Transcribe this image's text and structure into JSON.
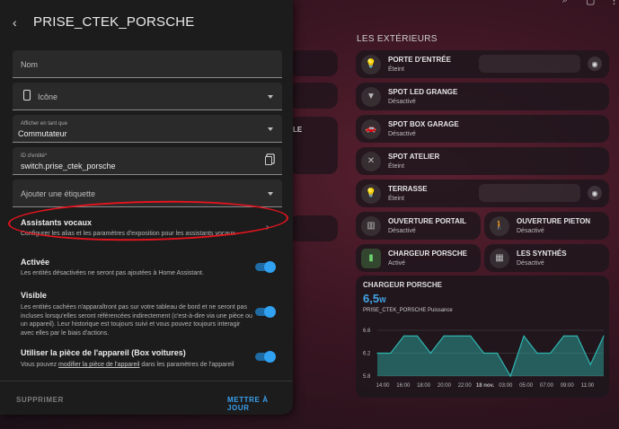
{
  "dialog": {
    "title": "PRISE_CTEK_PORSCHE",
    "name_field": {
      "label": "Nom"
    },
    "icon_field": {
      "label": "Icône"
    },
    "show_as_field": {
      "label": "Afficher en tant que",
      "value": "Commutateur"
    },
    "entity_id_field": {
      "label": "ID d'entité*",
      "value": "switch.prise_ctek_porsche"
    },
    "tag_field": {
      "label": "Ajouter une étiquette"
    },
    "voice_assistants": {
      "title": "Assistants vocaux",
      "description": "Configurer les alias et les paramètres d'exposition pour les assistants vocaux"
    },
    "enabled": {
      "title": "Activée",
      "description": "Les entités désactivées ne seront pas ajoutées à Home Assistant.",
      "on": true
    },
    "visible": {
      "title": "Visible",
      "description": "Les entités cachées n'apparaîtront pas sur votre tableau de bord et ne seront pas incluses lorsqu'elles seront référencées indirectement (c'est-à-dire via une pièce ou un appareil). Leur historique est toujours suivi et vous pouvez toujours interagir avec elles par le biais d'actions.",
      "on": true
    },
    "device_area": {
      "title": "Utiliser la pièce de l'appareil (Box voitures)",
      "desc_before": "Vous pouvez ",
      "desc_link": "modifier la pièce de l'appareil",
      "desc_after": " dans les paramètres de l'appareil",
      "on": true
    },
    "delete_label": "SUPPRIMER",
    "update_label": "METTRE À JOUR"
  },
  "dashboard": {
    "section_title": "LES EXTÉRIEURS",
    "peek_text": "LE",
    "tiles": [
      {
        "name": "PORTE D'ENTRÉE",
        "state": "Éteint",
        "icon": "lightbulb-icon"
      },
      {
        "name": "SPOT LED GRANGE",
        "state": "Désactivé",
        "icon": "spotlight-icon"
      },
      {
        "name": "SPOT BOX GARAGE",
        "state": "Désactivé",
        "icon": "car-icon"
      },
      {
        "name": "SPOT ATELIER",
        "state": "Éteint",
        "icon": "tools-icon"
      },
      {
        "name": "TERRASSE",
        "state": "Éteint",
        "icon": "lightbulb-icon"
      },
      {
        "name": "OUVERTURE PORTAIL",
        "state": "Désactivé",
        "icon": "gate-icon"
      },
      {
        "name": "OUVERTURE PIETON",
        "state": "Désactivé",
        "icon": "walk-icon"
      },
      {
        "name": "CHARGEUR PORSCHE",
        "state": "Activé",
        "icon": "ev-charger-icon"
      },
      {
        "name": "LES SYNTHÉS",
        "state": "Désactivé",
        "icon": "piano-icon"
      }
    ]
  },
  "chart_data": {
    "type": "area",
    "title": "CHARGEUR PORSCHE",
    "value": "6,5",
    "unit": "W",
    "series_label": "PRISE_CTEK_PORSCHE Puissance",
    "y_ticks": [
      "6.6",
      "6.2",
      "5.8"
    ],
    "ylim": [
      5.8,
      6.6
    ],
    "x_ticks": [
      "14:00",
      "16:00",
      "18:00",
      "20:00",
      "22:00",
      "18 nov.",
      "03:00",
      "05:00",
      "07:00",
      "09:00",
      "11:00"
    ],
    "values": [
      6.2,
      6.2,
      6.5,
      6.5,
      6.2,
      6.5,
      6.5,
      6.5,
      6.2,
      6.2,
      5.8,
      6.5,
      6.2,
      6.2,
      6.5,
      6.5,
      6.0,
      6.5
    ],
    "color": "#2fb5b0",
    "grid": true
  }
}
